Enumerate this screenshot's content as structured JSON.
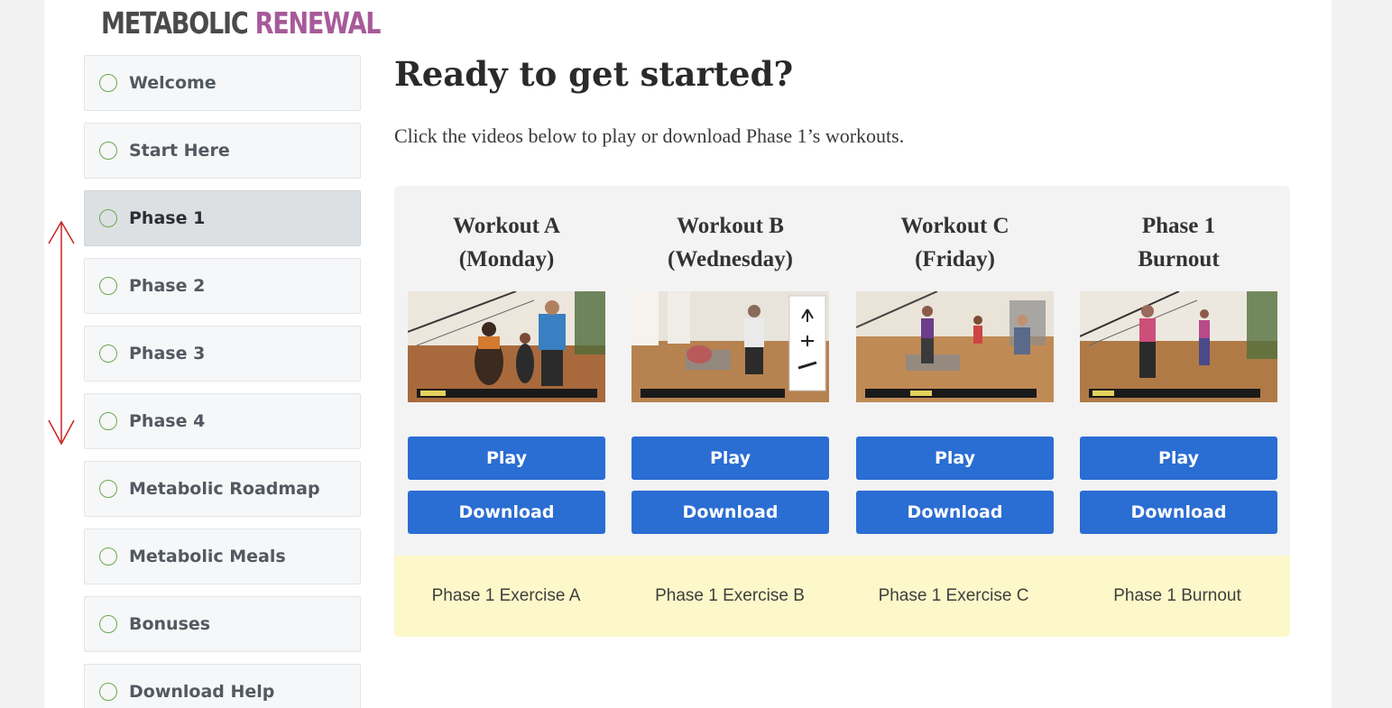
{
  "logo": {
    "word1": "METABOLIC",
    "word2": "RENEWAL"
  },
  "sidebar": {
    "items": [
      {
        "label": "Welcome",
        "active": false
      },
      {
        "label": "Start Here",
        "active": false
      },
      {
        "label": "Phase 1",
        "active": true
      },
      {
        "label": "Phase 2",
        "active": false
      },
      {
        "label": "Phase 3",
        "active": false
      },
      {
        "label": "Phase 4",
        "active": false
      },
      {
        "label": "Metabolic Roadmap",
        "active": false
      },
      {
        "label": "Metabolic Meals",
        "active": false
      },
      {
        "label": "Bonuses",
        "active": false
      },
      {
        "label": "Download Help",
        "active": false
      }
    ]
  },
  "main": {
    "title": "Ready to get started?",
    "intro": "Click the videos below to play or download Phase 1’s workouts.",
    "workouts": [
      {
        "title_line1": "Workout A",
        "title_line2": "(Monday)",
        "play_label": "Play",
        "download_label": "Download",
        "caption": "Phase 1 Exercise A"
      },
      {
        "title_line1": "Workout B",
        "title_line2": "(Wednesday)",
        "play_label": "Play",
        "download_label": "Download",
        "caption": "Phase 1 Exercise B"
      },
      {
        "title_line1": "Workout C",
        "title_line2": "(Friday)",
        "play_label": "Play",
        "download_label": "Download",
        "caption": "Phase 1 Exercise C"
      },
      {
        "title_line1": "Phase 1",
        "title_line2": "Burnout",
        "play_label": "Play",
        "download_label": "Download",
        "caption": "Phase 1 Burnout"
      }
    ]
  },
  "colors": {
    "accent_button": "#2a6dd3",
    "caption_background": "#fdf8c9",
    "logo_accent": "#a75a9a",
    "checkbox_green": "#6aa84f",
    "annotation_arrow": "#cc2222"
  },
  "icons": {
    "nav_status": "circle-outline-icon",
    "annotation": "double-headed-arrow"
  }
}
